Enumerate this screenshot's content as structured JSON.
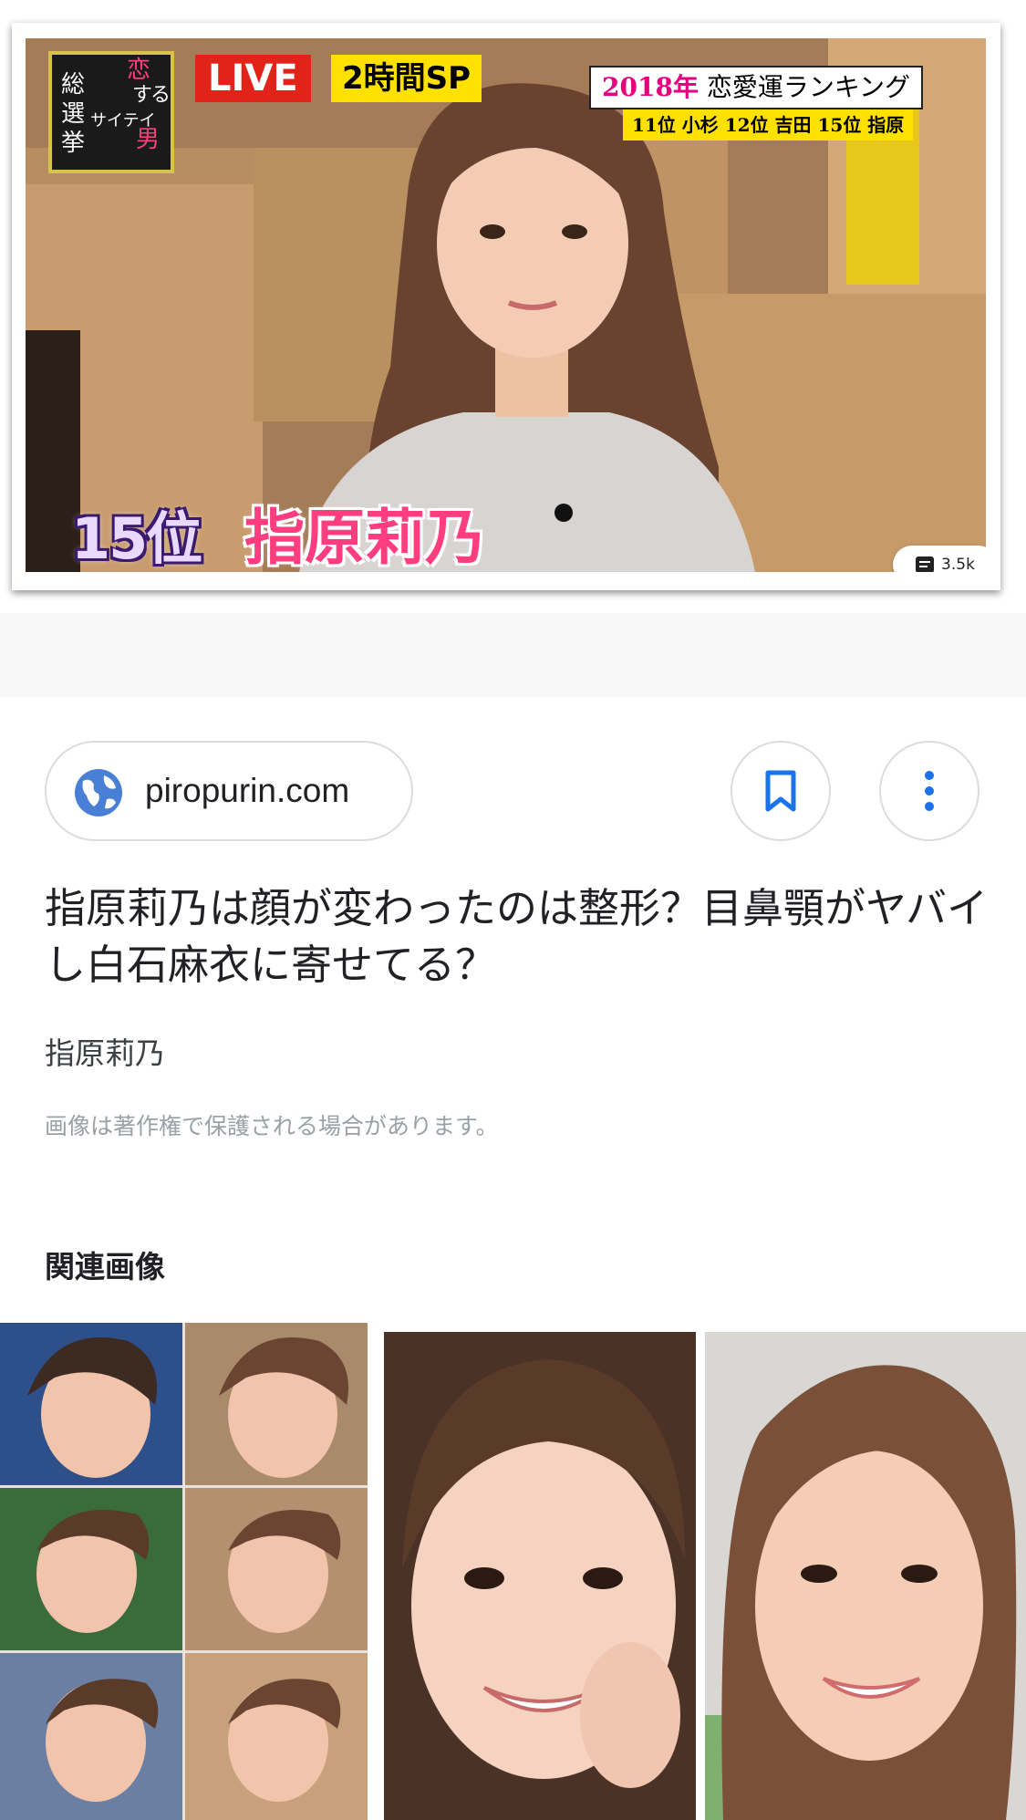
{
  "hero": {
    "logo_lines": [
      "総",
      "選",
      "挙",
      "恋",
      "す",
      "る",
      "サイテイ",
      "男"
    ],
    "live_label": "LIVE",
    "special_label": "2時間SP",
    "ranking_year": "2018年",
    "ranking_title": "恋愛運ランキング",
    "ranking_sub": "11位 小杉 12位 吉田 15位 指原",
    "caption_rank": "15位",
    "caption_name": "指原莉乃",
    "comment_count": "3.5k"
  },
  "source": {
    "domain": "piropurin.com",
    "icon": "globe-icon"
  },
  "actions": {
    "save_icon": "bookmark-icon",
    "more_icon": "more-vert-icon"
  },
  "result": {
    "title": "指原莉乃は顔が変わったのは整形？目鼻顎がヤバイし白石麻衣に寄せてる？",
    "subtitle": "指原莉乃",
    "copyright_notice": "画像は著作権で保護される場合があります。"
  },
  "related": {
    "heading": "関連画像"
  },
  "colors": {
    "accent_blue": "#1a73e8",
    "chip_border": "#dadce0",
    "text_primary": "#202124",
    "text_muted": "#9aa0a6"
  }
}
